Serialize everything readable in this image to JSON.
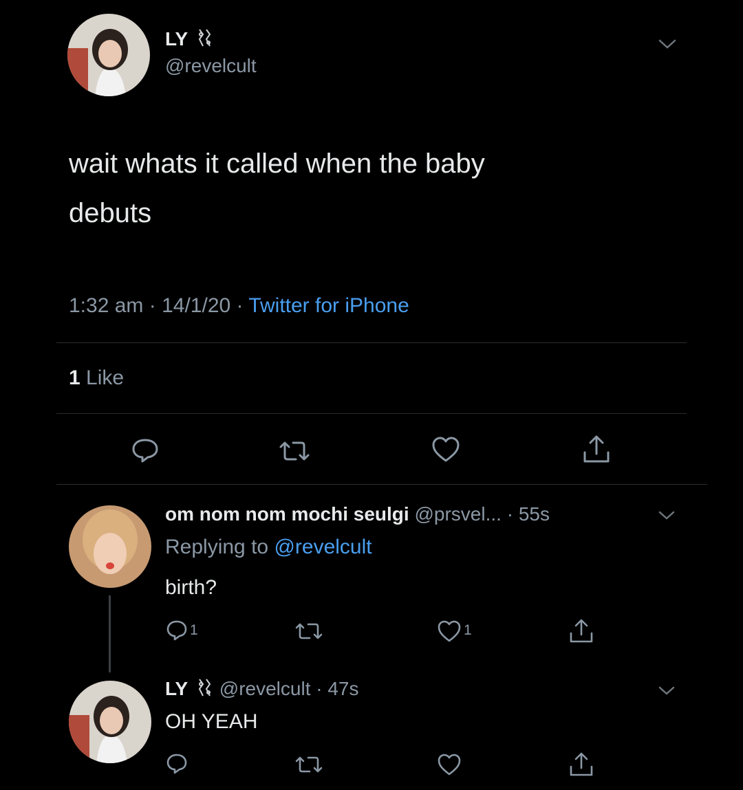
{
  "main_tweet": {
    "display_name": "LY",
    "handle": "@revelcult",
    "text_line1": "wait whats it called when the baby",
    "text_line2": "debuts",
    "time": "1:32 am",
    "sep1": "·",
    "date": "14/1/20",
    "sep2": "·",
    "source": "Twitter for iPhone",
    "likes_count": "1",
    "likes_label": "Like"
  },
  "reply1": {
    "display_name": "om nom nom mochi seulgi",
    "handle": "@prsvel...",
    "time": "· 55s",
    "replying_prefix": "Replying to",
    "replying_handle": "@revelcult",
    "text": "birth?",
    "reply_count": "1",
    "like_count": "1"
  },
  "reply2": {
    "display_name": "LY",
    "handle": "@revelcult",
    "time": "· 47s",
    "text": "OH YEAH"
  },
  "icons": {
    "reply": "comment-icon",
    "retweet": "retweet-icon",
    "like": "heart-icon",
    "share": "share-icon",
    "more": "chevron-down-icon"
  },
  "colors": {
    "background": "#000000",
    "text": "#e7e9ea",
    "muted": "#8b98a5",
    "link": "#4a9ff0"
  }
}
